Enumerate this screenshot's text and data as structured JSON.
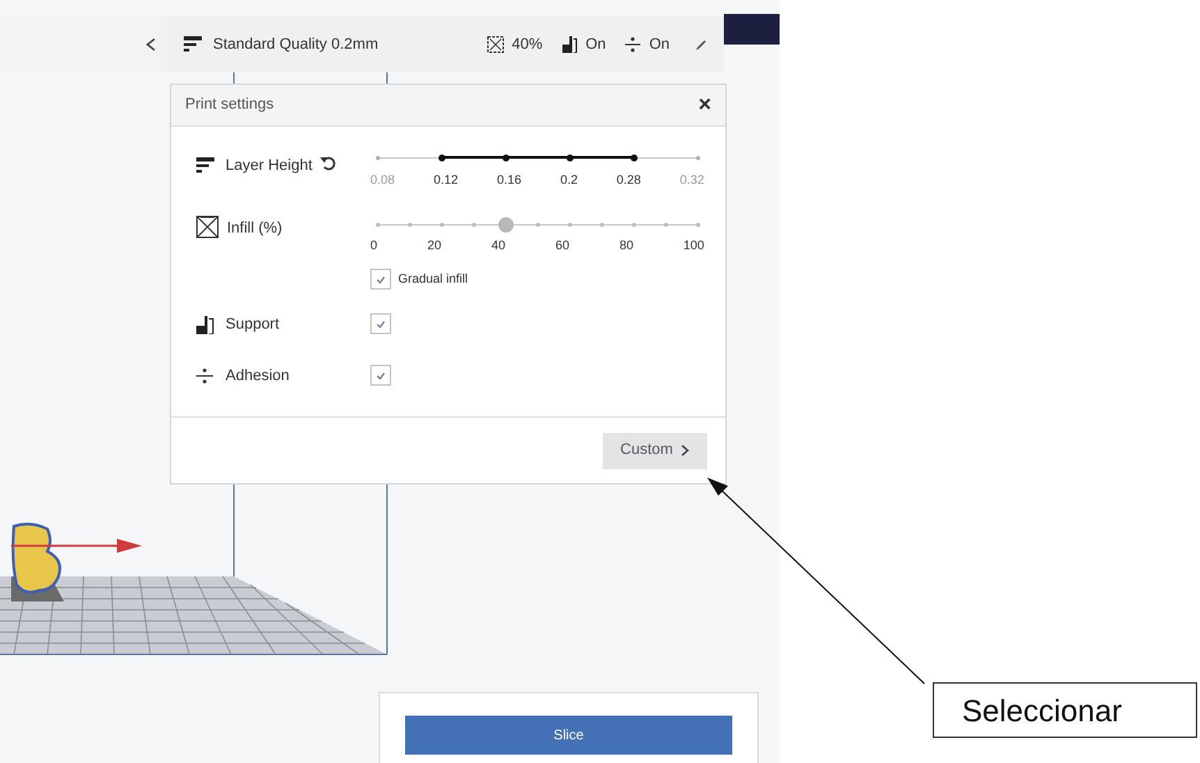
{
  "toolbar": {
    "profile": "Standard Quality 0.2mm",
    "infill": "40%",
    "support": "On",
    "adhesion": "On"
  },
  "print_settings": {
    "title": "Print settings",
    "close": "×",
    "layer_height": {
      "label": "Layer Height",
      "ticks": [
        {
          "label": "0.08",
          "enabled": false
        },
        {
          "label": "0.12",
          "enabled": true
        },
        {
          "label": "0.16",
          "enabled": true
        },
        {
          "label": "0.2",
          "enabled": true
        },
        {
          "label": "0.28",
          "enabled": true
        },
        {
          "label": "0.32",
          "enabled": false
        }
      ]
    },
    "infill": {
      "label": "Infill (%)",
      "level": 0.4,
      "ticks": [
        "0",
        "20",
        "40",
        "60",
        "80",
        "100"
      ]
    },
    "gradual_infill": {
      "label": "Gradual infill",
      "checked": true
    },
    "support": {
      "label": "Support",
      "checked": true
    },
    "adhesion": {
      "label": "Adhesion",
      "checked": true
    },
    "custom_button": "Custom"
  },
  "slice_button": "Slice",
  "annotation": "Seleccionar"
}
